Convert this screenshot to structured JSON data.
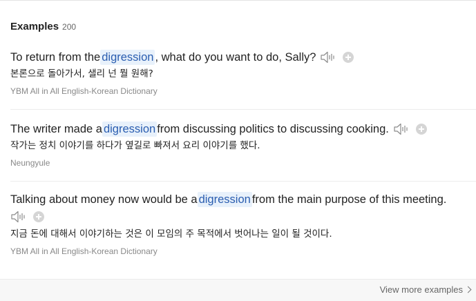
{
  "header": {
    "title": "Examples",
    "count": "200"
  },
  "examples": [
    {
      "en_before": "To return from the ",
      "en_highlight": "digression",
      "en_after": ", what do you want to do, Sally?",
      "ko": "본론으로 돌아가서, 샐리 넌 뭘 원해?",
      "source": "YBM All in All English-Korean Dictionary"
    },
    {
      "en_before": "The writer made a ",
      "en_highlight": "digression",
      "en_after": " from discussing politics to discussing cooking.",
      "ko": "작가는 정치 이야기를 하다가 옆길로 빠져서 요리 이야기를 했다.",
      "source": "Neungyule"
    },
    {
      "en_before": "Talking about money now would be a ",
      "en_highlight": "digression",
      "en_after": " from the main purpose of this meeting.",
      "ko": "지금 돈에 대해서 이야기하는 것은 이 모임의 주 목적에서 벗어나는 일이 될 것이다.",
      "source": "YBM All in All English-Korean Dictionary"
    }
  ],
  "icons": {
    "speaker": "speaker-icon",
    "add": "add-icon",
    "chevron": "chevron-right-icon"
  },
  "footer": {
    "view_more_label": "View more examples"
  }
}
